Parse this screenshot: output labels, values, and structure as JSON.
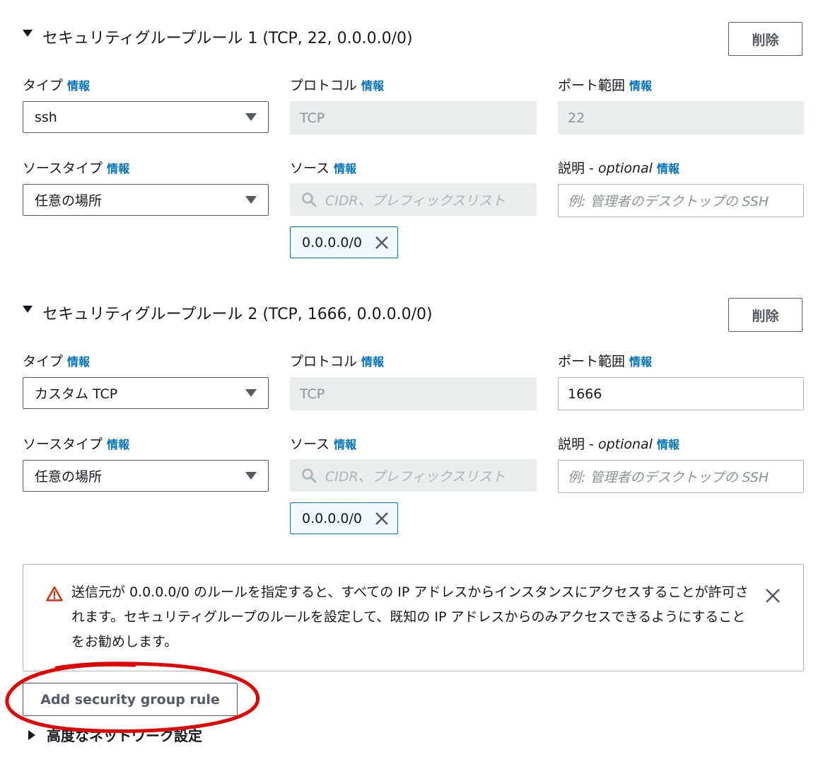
{
  "rules": [
    {
      "title": "セキュリティグループルール 1 (TCP, 22, 0.0.0.0/0)",
      "delete_label": "削除",
      "type_label": "タイプ",
      "type_value": "ssh",
      "protocol_label": "プロトコル",
      "protocol_value": "TCP",
      "port_label": "ポート範囲",
      "port_value": "22",
      "source_type_label": "ソースタイプ",
      "source_type_value": "任意の場所",
      "source_label": "ソース",
      "source_placeholder": "CIDR、プレフィックスリスト",
      "source_token": "0.0.0.0/0",
      "desc_label": "説明",
      "desc_optional": "optional",
      "desc_placeholder": "例: 管理者のデスクトップの SSH"
    },
    {
      "title": "セキュリティグループルール 2 (TCP, 1666, 0.0.0.0/0)",
      "delete_label": "削除",
      "type_label": "タイプ",
      "type_value": "カスタム TCP",
      "protocol_label": "プロトコル",
      "protocol_value": "TCP",
      "port_label": "ポート範囲",
      "port_value": "1666",
      "source_type_label": "ソースタイプ",
      "source_type_value": "任意の場所",
      "source_label": "ソース",
      "source_placeholder": "CIDR、プレフィックスリスト",
      "source_token": "0.0.0.0/0",
      "desc_label": "説明",
      "desc_optional": "optional",
      "desc_placeholder": "例: 管理者のデスクトップの SSH"
    }
  ],
  "info_label": "情報",
  "optional_sep": " - ",
  "warning": {
    "text": "送信元が 0.0.0.0/0 のルールを指定すると、すべての IP アドレスからインスタンスにアクセスすることが許可されます。セキュリティグループのルールを設定して、既知の IP アドレスからのみアクセスできるようにすることをお勧めします。"
  },
  "add_rule_label": "Add security group rule",
  "advanced_label": "高度なネットワーク設定",
  "colors": {
    "link": "#0073bb",
    "warning_icon": "#d13212",
    "annotation": "#e00000"
  }
}
